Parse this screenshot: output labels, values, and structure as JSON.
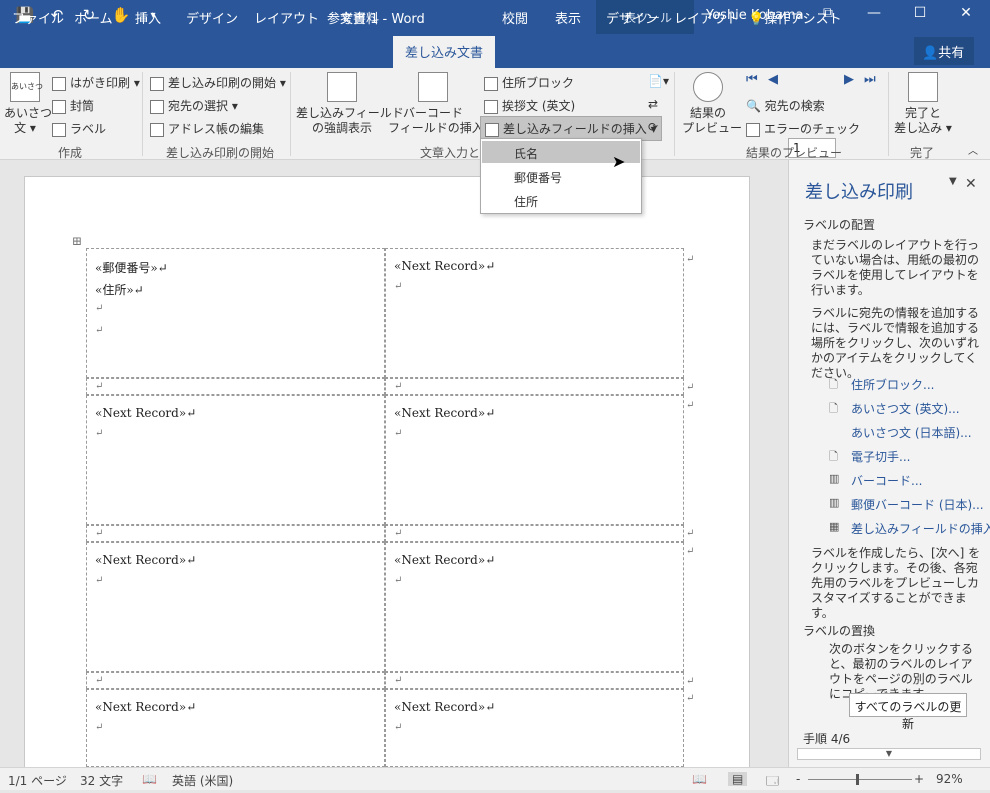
{
  "window": {
    "title": "文書 1 - Word",
    "contextual_label": "表ツール",
    "user": "Yoshie Kohama",
    "accent": "#2b579a"
  },
  "qat": {
    "icons": [
      "save-icon",
      "undo-icon",
      "redo-icon",
      "touch-mode-icon",
      "customize-icon"
    ]
  },
  "tabs": [
    "ファイル",
    "ホーム",
    "挿入",
    "デザイン",
    "レイアウト",
    "参考資料",
    "差し込み文書",
    "校閲",
    "表示",
    "デザイン",
    "レイアウト",
    "操作アシスト"
  ],
  "share_label": "共有",
  "ribbon": {
    "create": {
      "greeting_label": "あいさつ",
      "greeting_label2": "文",
      "greeting_icon_text": "あいさつ",
      "postcard": "はがき印刷",
      "envelope": "封筒",
      "label": "ラベル",
      "group": "作成"
    },
    "start": {
      "start_merge": "差し込み印刷の開始",
      "select_recipients": "宛先の選択",
      "edit_list": "アドレス帳の編集",
      "group": "差し込み印刷の開始"
    },
    "write": {
      "highlight_1": "差し込みフィールド",
      "highlight_2": "の強調表示",
      "barcode_1": "バーコード",
      "barcode_2": "フィールドの挿入",
      "address_block": "住所ブロック",
      "greeting_line": "挨拶文 (英文)",
      "insert_field": "差し込みフィールドの挿入",
      "group": "文章入力と"
    },
    "preview": {
      "preview_1": "結果の",
      "preview_2": "プレビュー",
      "record": "1",
      "find_recipient": "宛先の検索",
      "check_errors": "エラーのチェック",
      "group": "結果のプレビュー"
    },
    "finish": {
      "finish_1": "完了と",
      "finish_2": "差し込み",
      "group": "完了"
    }
  },
  "dropdown": {
    "items": [
      "氏名",
      "郵便番号",
      "住所"
    ],
    "highlighted": 0
  },
  "document": {
    "first_cell": [
      "«郵便番号»↵",
      "«住所»↵",
      "↵",
      "↵"
    ],
    "next_record": "«Next Record»↵",
    "empty_mark": "↵"
  },
  "taskpane": {
    "title": "差し込み印刷",
    "section1": "ラベルの配置",
    "text1": "まだラベルのレイアウトを行っていない場合は、用紙の最初のラベルを使用してレイアウトを行います。",
    "text2": "ラベルに宛先の情報を追加するには、ラベルで情報を追加する場所をクリックし、次のいずれかのアイテムをクリックしてください。",
    "links": [
      "住所ブロック...",
      "あいさつ文 (英文)...",
      "あいさつ文 (日本語)...",
      "電子切手...",
      "バーコード...",
      "郵便バーコード (日本)...",
      "差し込みフィールドの挿入..."
    ],
    "text3": "ラベルを作成したら、[次へ] をクリックします。その後、各宛先用のラベルをプレビューしカスタマイズすることができます。",
    "section2": "ラベルの置換",
    "text4": "次のボタンをクリックすると、最初のラベルのレイアウトをページの別のラベルにコピーできます。",
    "update_button": "すべてのラベルの更新",
    "step": "手順 4/6"
  },
  "statusbar": {
    "page": "1/1 ページ",
    "words": "32 文字",
    "language": "英語 (米国)",
    "zoom_minus": "-",
    "zoom_plus": "+",
    "zoom": "92%",
    "zoom_level": 0.46
  }
}
